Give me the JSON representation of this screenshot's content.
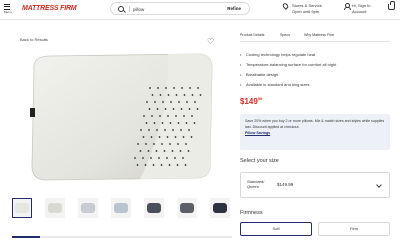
{
  "header": {
    "menu_label": "Menu",
    "logo": "MATTRESS FIRM",
    "search": {
      "value": "pillow",
      "refine_label": "Refine"
    },
    "store": {
      "line1": "Stores & Service",
      "line2": "Open until 9pm"
    },
    "account": {
      "line1": "Hi, Sign In",
      "line2": "Account"
    }
  },
  "product": {
    "breadcrumb": "Back to Results",
    "tabs": [
      "Product Details",
      "Specs",
      "Why Mattress Firm"
    ],
    "features": [
      "Cooling technology helps regulate heat",
      "Temperature-balancing surface for comfort all night",
      "Breathable design",
      "Available in standard and king sizes"
    ],
    "price": {
      "whole": "$149",
      "cents": "99"
    },
    "promo": {
      "text": "Save 20% when you buy 2 or more pillows. Mix & match sizes and styles while supplies last. Discount applied at checkout.",
      "link": "Pillow Savings"
    },
    "size_title": "Select your size",
    "size_option": {
      "name_line1": "Standard/",
      "name_line2": "Queen",
      "price": "$149.99"
    },
    "firmness_title": "Firmness",
    "firmness_options": [
      "Soft",
      "Firm"
    ]
  },
  "colors": {
    "brand_red": "#d52b1e",
    "navy": "#1f2f6b"
  }
}
